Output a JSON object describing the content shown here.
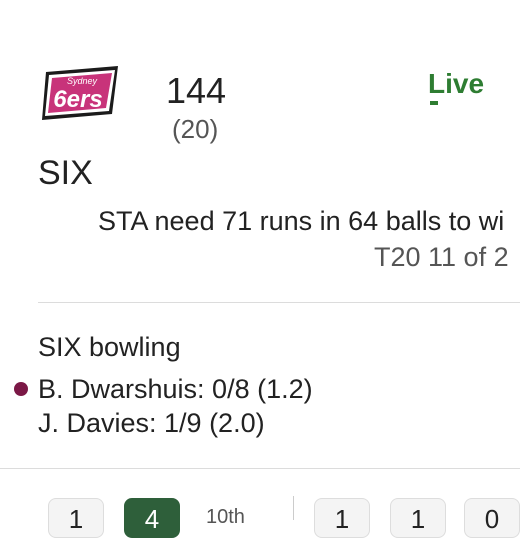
{
  "team": {
    "logo_text": "6ers",
    "logo_subtext": "Sydney",
    "score": "144",
    "overs": "(20)",
    "abbr": "SIX"
  },
  "live_label": "Live",
  "status_text": "STA need 71 runs in 64 balls to wi",
  "format_text": "T20 11 of 2",
  "bowling": {
    "title": "SIX bowling",
    "bowlers": [
      "B. Dwarshuis: 0/8 (1.2)",
      "J. Davies: 1/9 (2.0)"
    ]
  },
  "balls": {
    "left": [
      "1",
      "4"
    ],
    "over_label": "10th",
    "right": [
      "1",
      "1",
      "0"
    ]
  },
  "colors": {
    "live_green": "#2e7d32",
    "current_bowler_dot": "#7b1846",
    "selected_ball": "#2e5f3a",
    "logo_pink": "#c8337a"
  }
}
